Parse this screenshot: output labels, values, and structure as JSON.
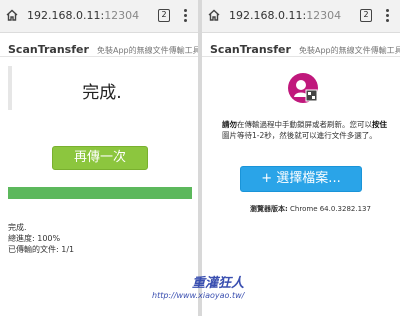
{
  "left": {
    "urlbar": {
      "host": "192.168.0.11:",
      "port": "12304",
      "tab_count": "2"
    },
    "app": {
      "name": "ScanTransfer",
      "slogan": "免裝App的無線文件傳輸工具"
    },
    "status_title": "完成.",
    "again_label": "再傳一次",
    "progress_fraction": 1.0,
    "stats": [
      "完成.",
      "總進度: 100%",
      "已傳輸的文件: 1/1"
    ],
    "watermark_name": "重灌狂人",
    "watermark_url": "http://www.xiaoyao.tw/"
  },
  "right": {
    "urlbar": {
      "host": "192.168.0.11:",
      "port": "12304",
      "tab_count": "2"
    },
    "app": {
      "name": "ScanTransfer",
      "slogan": "免裝App的無線文件傳輸工具"
    },
    "notice_bold1": "請勿",
    "notice_mid": "在傳輸過程中手動鎖屏或者刷新。您可以",
    "notice_bold2": "按住",
    "notice_end": "圖片等待1-2秒，然後就可以進行文件多選了。",
    "choose_label": "+ 選擇檔案...",
    "browser_label": "瀏覽器版本:",
    "browser_value": "Chrome 64.0.3282.137"
  },
  "colors": {
    "again_button": "#8cc63e",
    "progress_fill": "#5cb85c",
    "choose_button": "#2aa4e8",
    "logo": "#c0187c"
  }
}
